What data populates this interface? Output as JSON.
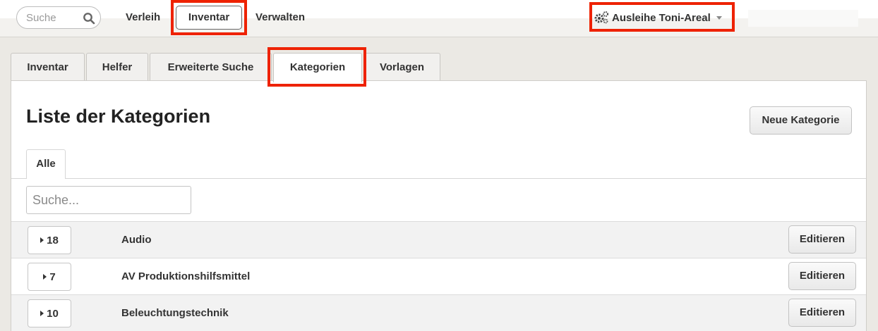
{
  "topnav": {
    "search_placeholder": "Suche",
    "links": [
      "Verleih",
      "Inventar",
      "Verwalten"
    ],
    "active_link": "Inventar",
    "inventory_pool": "Ausleihe Toni-Areal"
  },
  "tabs": [
    "Inventar",
    "Helfer",
    "Erweiterte Suche",
    "Kategorien",
    "Vorlagen"
  ],
  "active_tab": "Kategorien",
  "page": {
    "title": "Liste der Kategorien",
    "new_button": "Neue Kategorie",
    "filter_tab": "Alle",
    "search_placeholder": "Suche..."
  },
  "categories": [
    {
      "count": "18",
      "name": "Audio",
      "edit_label": "Editieren"
    },
    {
      "count": "7",
      "name": "AV Produktionshilfsmittel",
      "edit_label": "Editieren"
    },
    {
      "count": "10",
      "name": "Beleuchtungstechnik",
      "edit_label": "Editieren"
    }
  ],
  "colors": {
    "highlight": "#ee2200",
    "background": "#ebe9e4",
    "row_alt": "#f2f2f2"
  }
}
